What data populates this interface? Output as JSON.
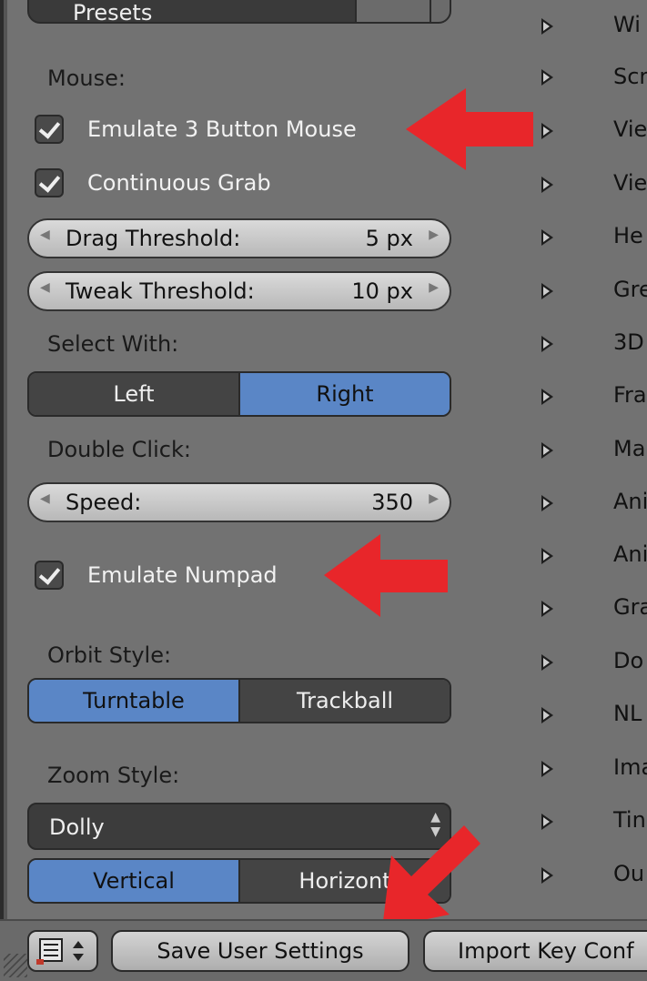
{
  "presets": {
    "label": "Presets"
  },
  "mouse": {
    "heading": "Mouse:",
    "emulate_3_button": {
      "label": "Emulate 3 Button Mouse",
      "checked": true
    },
    "continuous_grab": {
      "label": "Continuous Grab",
      "checked": true
    },
    "drag_threshold": {
      "label": "Drag Threshold:",
      "value": "5 px"
    },
    "tweak_threshold": {
      "label": "Tweak Threshold:",
      "value": "10 px"
    }
  },
  "select_with": {
    "heading": "Select With:",
    "options": [
      "Left",
      "Right"
    ],
    "selected": "Right"
  },
  "double_click": {
    "heading": "Double Click:",
    "speed_label": "Speed:",
    "speed_value": "350"
  },
  "emulate_numpad": {
    "label": "Emulate Numpad",
    "checked": true
  },
  "orbit_style": {
    "heading": "Orbit Style:",
    "options": [
      "Turntable",
      "Trackball"
    ],
    "selected": "Turntable"
  },
  "zoom_style": {
    "heading": "Zoom Style:",
    "dropdown_value": "Dolly",
    "options": [
      "Vertical",
      "Horizont"
    ],
    "selected": "Vertical"
  },
  "keymap_categories": [
    "Wi",
    "Scr",
    "Vie",
    "Vie",
    "He",
    "Gre",
    "3D",
    "Fra",
    "Ma",
    "Ani",
    "Ani",
    "Gra",
    "Do",
    "NL",
    "Ima",
    "Tin",
    "Ou"
  ],
  "footer": {
    "save_user_settings": "Save User Settings",
    "import_key_config": "Import Key Conf"
  },
  "colors": {
    "panel_bg": "#727272",
    "active_blue": "#5a86c6",
    "annotation_red": "#e8262a"
  }
}
